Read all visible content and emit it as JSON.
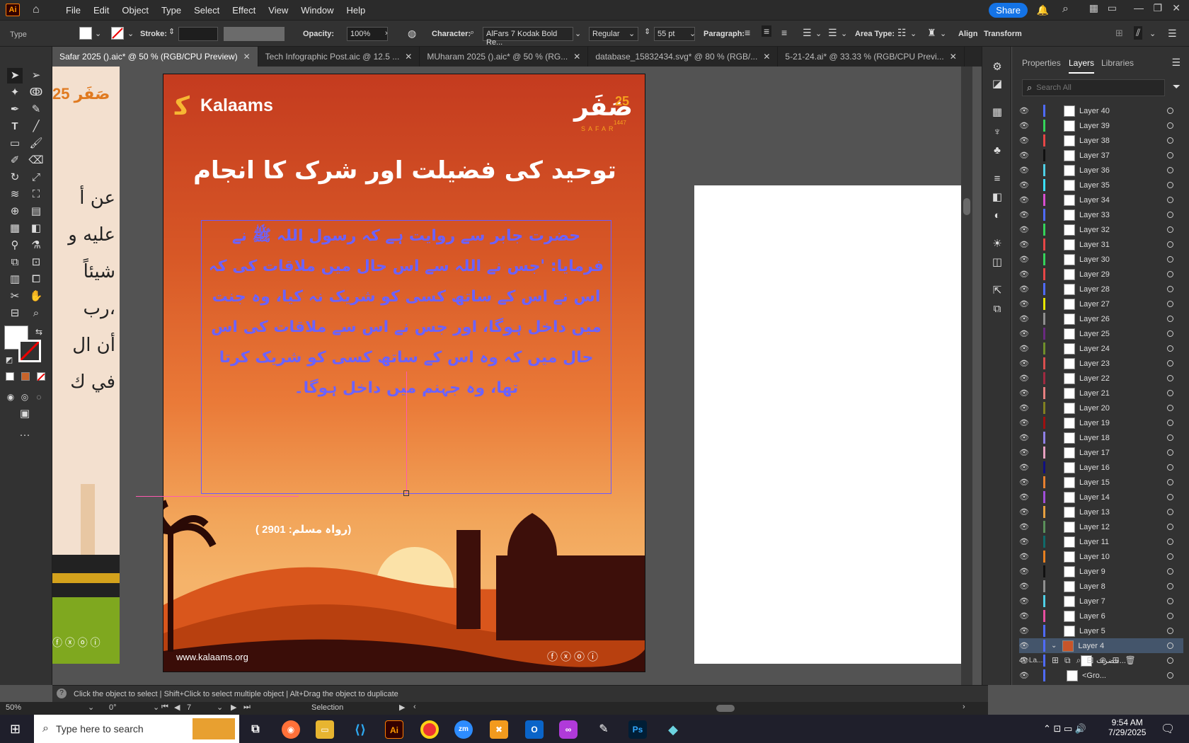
{
  "app": {
    "logo": "Ai",
    "menu": [
      "File",
      "Edit",
      "Object",
      "Type",
      "Select",
      "Effect",
      "View",
      "Window",
      "Help"
    ],
    "share_label": "Share"
  },
  "control": {
    "type_label": "Type",
    "stroke_label": "Stroke:",
    "opacity_label": "Opacity:",
    "opacity_value": "100%",
    "character_label": "Character:",
    "font_name": "AlFars 7 Kodak Bold Re...",
    "font_style": "Regular",
    "font_size": "55 pt",
    "paragraph_label": "Paragraph:",
    "area_type_label": "Area Type:",
    "align_label": "Align",
    "transform_label": "Transform"
  },
  "tabs": [
    {
      "label": "Safar 2025 ().aic* @ 50 % (RGB/CPU Preview)"
    },
    {
      "label": "Tech Infographic Post.aic @ 12.5 ..."
    },
    {
      "label": "MUharam 2025 ().aic* @ 50 % (RG..."
    },
    {
      "label": "database_15832434.svg* @ 80 % (RGB/..."
    },
    {
      "label": "5-21-24.ai* @ 33.33 % (RGB/CPU Previ..."
    }
  ],
  "poster": {
    "brand": "Kalaams",
    "badge_number": "25",
    "badge_arabic": "صَفَر",
    "badge_latin": "SAFAR",
    "badge_year": "1447",
    "title": "توحید کی فضیلت اور شرک کا انجام",
    "body_lines": [
      "حضرت جابر سے روایت ہے کہ رسول اللہ ﷺ نے",
      "فرمایا: 'جس نے اللہ سے اس حال میں ملاقات کی کہ",
      "اس نے اس کے ساتھ کسی کو شریک نہ کیا، وہ جنت",
      "میں داخل ہوگا، اور جس نے اس سے ملاقات کی اس",
      "حال میں کہ وہ اس کے ساتھ کسی کو شریک کرتا",
      "تھا، وہ جہنم میں داخل ہوگا۔"
    ],
    "reference": "(رواہ مسلم: 2901 )",
    "website": "www.kalaams.org"
  },
  "left_art_text": [
    "عن أ",
    "عليه و",
    "شيئاً",
    "رب،",
    "أن ال",
    "في ك"
  ],
  "panel": {
    "tabs": [
      "Properties",
      "Layers",
      "Libraries"
    ],
    "search_placeholder": "Search All",
    "layers": [
      "Layer 40",
      "Layer 39",
      "Layer 38",
      "Layer 37",
      "Layer 36",
      "Layer 35",
      "Layer 34",
      "Layer 33",
      "Layer 32",
      "Layer 31",
      "Layer 30",
      "Layer 29",
      "Layer 28",
      "Layer 27",
      "Layer 26",
      "Layer 25",
      "Layer 24",
      "Layer 23",
      "Layer 22",
      "Layer 21",
      "Layer 20",
      "Layer 19",
      "Layer 18",
      "Layer 17",
      "Layer 16",
      "Layer 15",
      "Layer 14",
      "Layer 13",
      "Layer 12",
      "Layer 11",
      "Layer 10",
      "Layer 9",
      "Layer 8",
      "Layer 7",
      "Layer 6",
      "Layer 5",
      "Layer 4"
    ],
    "layer_colors": [
      "#4f6bff",
      "#35d45a",
      "#e64646",
      "#111111",
      "#4fd0e6",
      "#3ae0ff",
      "#d94fd0",
      "#4f6bff",
      "#35d45a",
      "#e64646",
      "#35d45a",
      "#e64646",
      "#4f6bff",
      "#e6e600",
      "#8f8f8f",
      "#6a2a80",
      "#6f8f2a",
      "#d94f4f",
      "#a02a40",
      "#e68080",
      "#808020",
      "#a01010",
      "#8f80e6",
      "#e6a0c0",
      "#101080",
      "#e68030",
      "#a04fd9",
      "#e6a040",
      "#5a8f5a",
      "#106a6a",
      "#e68020",
      "#111111",
      "#8f8f8f",
      "#4fd0e6",
      "#e64fa0",
      "#4f6bff"
    ],
    "sublayers": [
      "حضرت...",
      "<Gro..."
    ],
    "footer_count": "40 La..."
  },
  "status": {
    "hint": "Click the object to select  |  Shift+Click to select multiple object  |  Alt+Drag the object to duplicate"
  },
  "bottom": {
    "zoom": "50%",
    "rotation": "0°",
    "artboard": "7",
    "mode": "Selection"
  },
  "taskbar": {
    "search_placeholder": "Type here to search",
    "time": "9:54 AM",
    "date": "7/29/2025"
  }
}
